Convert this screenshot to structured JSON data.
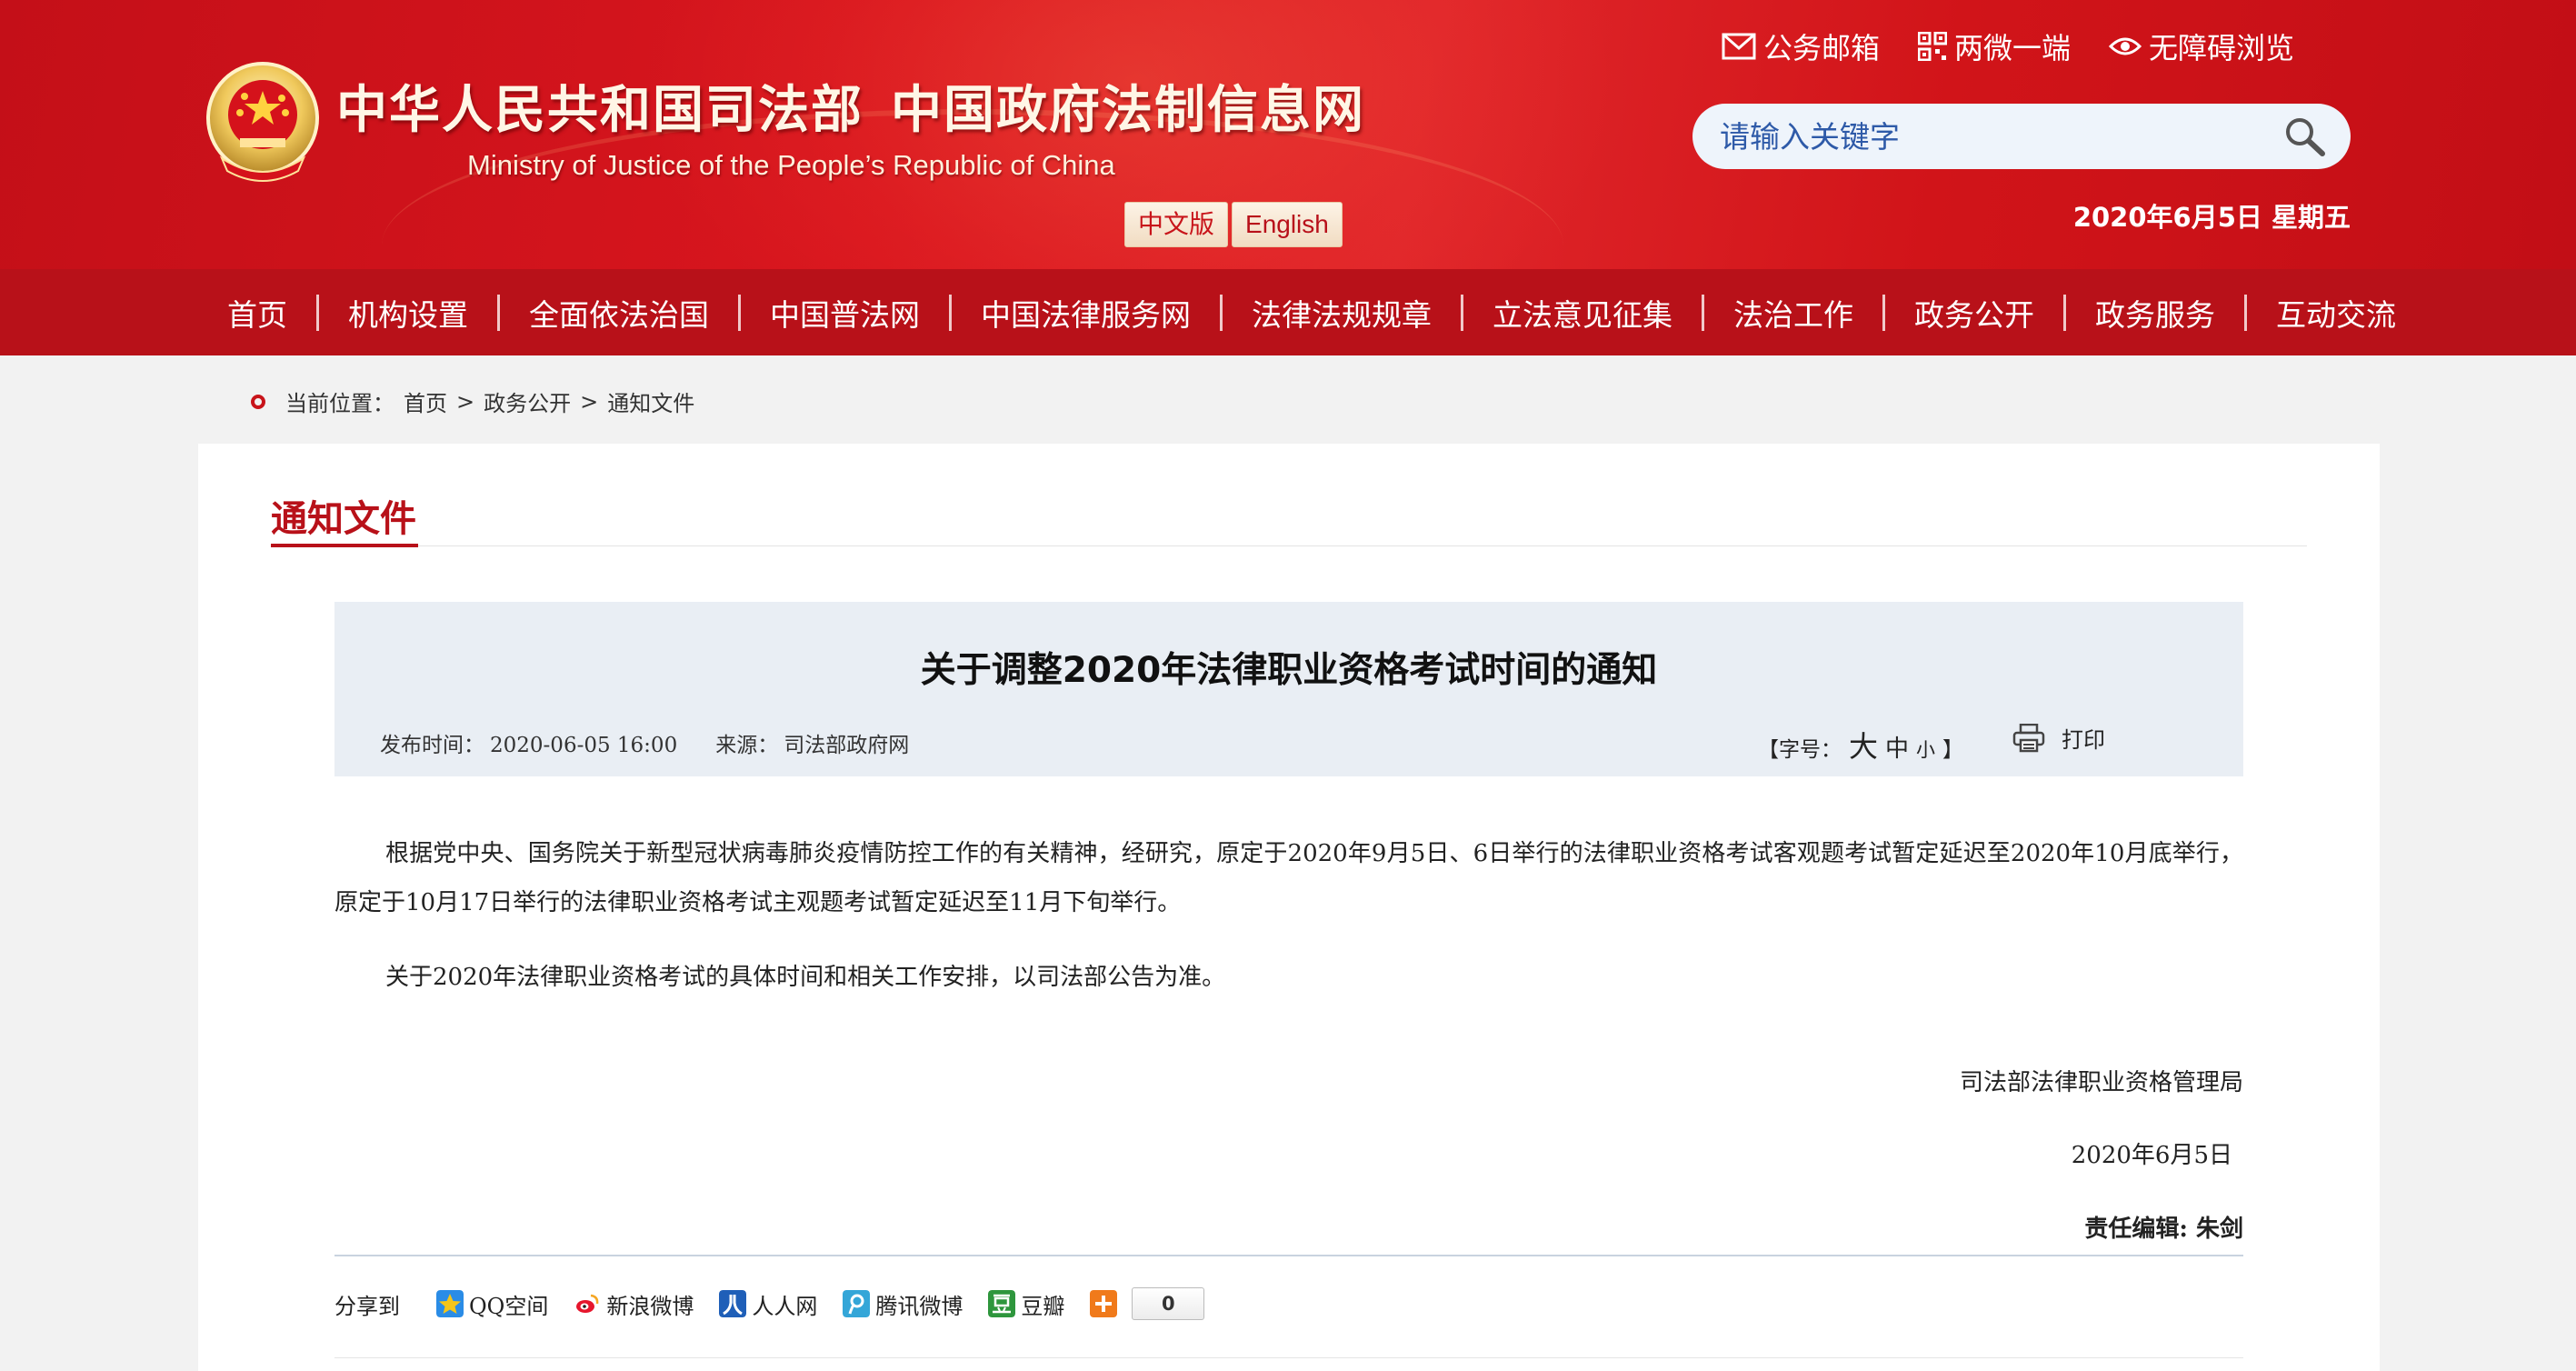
{
  "header": {
    "title_part1": "中华人民共和国司法部",
    "title_part2": "中国政府法制信息网",
    "subtitle": "Ministry of Justice of the People’s Republic of China",
    "lang_cn": "中文版",
    "lang_en": "English",
    "top_links": [
      {
        "label": "公务邮箱",
        "icon": "mail-icon"
      },
      {
        "label": "两微一端",
        "icon": "qrcode-icon"
      },
      {
        "label": "无障碍浏览",
        "icon": "eye-icon"
      }
    ],
    "search_placeholder": "请输入关键字",
    "date": "2020年6月5日 星期五"
  },
  "nav": {
    "items": [
      "首页",
      "机构设置",
      "全面依法治国",
      "中国普法网",
      "中国法律服务网",
      "法律法规规章",
      "立法意见征集",
      "法治工作",
      "政务公开",
      "政务服务",
      "互动交流"
    ]
  },
  "breadcrumb": {
    "label": "当前位置：",
    "items": [
      "首页",
      "政务公开",
      "通知文件"
    ],
    "separator": ">"
  },
  "section": {
    "title": "通知文件"
  },
  "article": {
    "title": "关于调整2020年法律职业资格考试时间的通知",
    "publish_label": "发布时间：",
    "publish_time": "2020-06-05 16:00",
    "source_label": "来源：",
    "source": "司法部政府网",
    "font_label": "【字号：",
    "font_big": "大",
    "font_mid": "中",
    "font_small": "小",
    "font_close": "】",
    "print_label": "打印",
    "paragraphs": [
      "根据党中央、国务院关于新型冠状病毒肺炎疫情防控工作的有关精神，经研究，原定于2020年9月5日、6日举行的法律职业资格考试客观题考试暂定延迟至2020年10月底举行，原定于10月17日举行的法律职业资格考试主观题考试暂定延迟至11月下旬举行。",
      "关于2020年法律职业资格考试的具体时间和相关工作安排，以司法部公告为准。"
    ],
    "signature": "司法部法律职业资格管理局",
    "sign_date": "2020年6月5日",
    "editor": "责任编辑: 朱剑"
  },
  "share": {
    "label": "分享到",
    "items": [
      {
        "label": "QQ空间",
        "icon": "qzone-icon",
        "color": "#f5a623"
      },
      {
        "label": "新浪微博",
        "icon": "weibo-icon",
        "color": "#e6162d"
      },
      {
        "label": "人人网",
        "icon": "renren-icon",
        "color": "#1f5fb8"
      },
      {
        "label": "腾讯微博",
        "icon": "tencent-weibo-icon",
        "color": "#34a6d8"
      },
      {
        "label": "豆瓣",
        "icon": "douban-icon",
        "color": "#2e963d"
      }
    ],
    "more_icon": "plus-icon",
    "more_color": "#f07a1b",
    "count": "0"
  },
  "colors": {
    "header_red": "#d9161e",
    "nav_red": "#b81119",
    "accent": "#b81119",
    "article_head_bg": "#e9eef4"
  }
}
